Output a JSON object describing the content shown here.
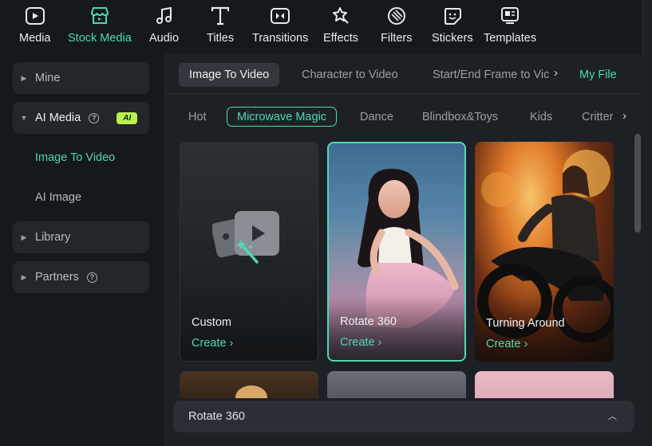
{
  "toolbar": {
    "items": [
      {
        "label": "Media",
        "icon": "media-icon"
      },
      {
        "label": "Stock Media",
        "icon": "stock-media-icon"
      },
      {
        "label": "Audio",
        "icon": "audio-icon"
      },
      {
        "label": "Titles",
        "icon": "titles-icon"
      },
      {
        "label": "Transitions",
        "icon": "transitions-icon"
      },
      {
        "label": "Effects",
        "icon": "effects-icon"
      },
      {
        "label": "Filters",
        "icon": "filters-icon"
      },
      {
        "label": "Stickers",
        "icon": "stickers-icon"
      },
      {
        "label": "Templates",
        "icon": "templates-icon"
      }
    ],
    "active": "Stock Media",
    "accent": "#4fd8b3"
  },
  "sidebar": {
    "mine": "Mine",
    "ai_media": "AI Media",
    "ai_badge": "AI",
    "image_to_video": "Image To Video",
    "ai_image": "AI Image",
    "library": "Library",
    "partners": "Partners"
  },
  "tabs": {
    "image_to_video": "Image To Video",
    "character_to_video": "Character to Video",
    "start_end_frame": "Start/End Frame to Vic",
    "my_file": "My File"
  },
  "categories": [
    "Hot",
    "Microwave Magic",
    "Dance",
    "Blindbox&Toys",
    "Kids",
    "Critter"
  ],
  "active_category": "Microwave Magic",
  "cards": [
    {
      "title": "Custom",
      "action": "Create"
    },
    {
      "title": "Rotate 360",
      "action": "Create"
    },
    {
      "title": "Turning Around",
      "action": "Create"
    }
  ],
  "bottom": {
    "selected": "Rotate 360"
  }
}
